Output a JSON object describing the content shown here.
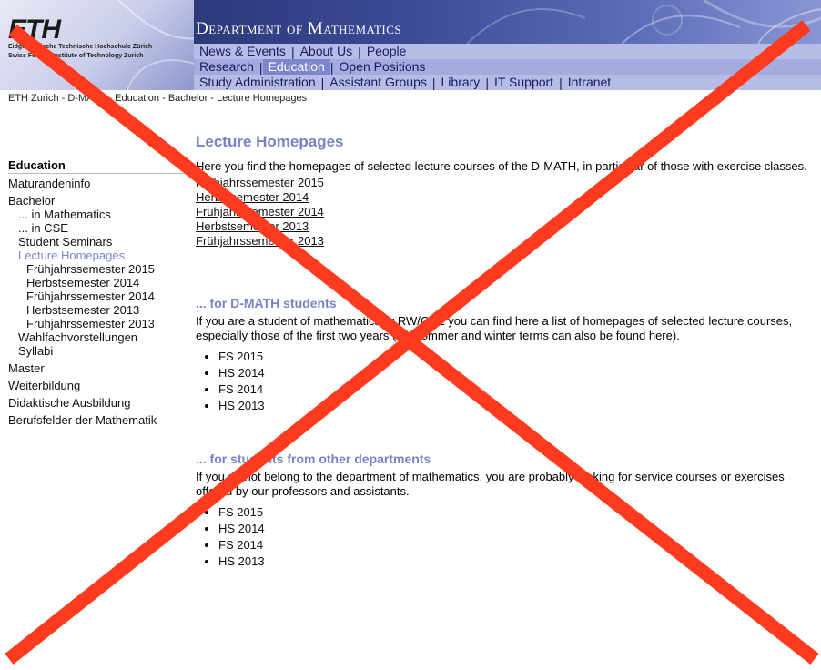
{
  "header": {
    "logo": {
      "wordmark": "ETH",
      "line1": "Eidgenössische Technische Hochschule Zürich",
      "line2": "Swiss Federal Institute of Technology Zurich"
    },
    "dept_title": "Department of Mathematics",
    "nav_rows": [
      {
        "items": [
          {
            "label": "News & Events"
          },
          {
            "label": "About Us"
          },
          {
            "label": "People"
          }
        ]
      },
      {
        "items": [
          {
            "label": "Research"
          },
          {
            "label": "Education",
            "active": true
          },
          {
            "label": "Open Positions"
          }
        ]
      },
      {
        "items": [
          {
            "label": "Study Administration"
          },
          {
            "label": "Assistant Groups"
          },
          {
            "label": "Library"
          },
          {
            "label": "IT Support"
          },
          {
            "label": "Intranet"
          }
        ]
      }
    ],
    "nav_separator": "|"
  },
  "breadcrumb": "ETH Zurich - D-MATH - Education - Bachelor - Lecture Homepages",
  "sidebar": {
    "heading": "Education",
    "items": [
      {
        "label": "Maturandeninfo",
        "level": 1
      },
      {
        "label": "Bachelor",
        "level": 1
      },
      {
        "label": "... in Mathematics",
        "level": 2
      },
      {
        "label": "... in CSE",
        "level": 2
      },
      {
        "label": "Student Seminars",
        "level": 2
      },
      {
        "label": "Lecture Homepages",
        "level": 2,
        "active": true
      },
      {
        "label": "Frühjahrssemester 2015",
        "level": 3
      },
      {
        "label": "Herbstsemester 2014",
        "level": 3
      },
      {
        "label": "Frühjahrssemester 2014",
        "level": 3
      },
      {
        "label": "Herbstsemester 2013",
        "level": 3
      },
      {
        "label": "Frühjahrssemester 2013",
        "level": 3
      },
      {
        "label": "Wahlfachvorstellungen",
        "level": 2
      },
      {
        "label": "Syllabi",
        "level": 2
      },
      {
        "label": "Master",
        "level": 1
      },
      {
        "label": "Weiterbildung",
        "level": 1
      },
      {
        "label": "Didaktische Ausbildung",
        "level": 1
      },
      {
        "label": "Berufsfelder der Mathematik",
        "level": 1
      }
    ]
  },
  "main": {
    "title": "Lecture Homepages",
    "intro": "Here you find the homepages of selected lecture courses of the D-MATH, in particular of those with exercise classes.",
    "term_links": [
      "Frühjahrssemester 2015",
      "Herbstsemester 2014",
      "Frühjahrssemester 2014",
      "Herbstsemester 2013",
      "Frühjahrssemester 2013"
    ],
    "dmath_section": {
      "heading": "... for D-MATH students",
      "text": "If you are a student of mathematics or RW/CSE you can find here a list of homepages of selected lecture courses, especially those of the first two years (old sommer and winter terms can also be found here).",
      "links": [
        "FS 2015",
        "HS 2014",
        "FS 2014",
        "HS 2013"
      ]
    },
    "other_section": {
      "heading": "... for students from other departments",
      "text": "If you do not belong to the department of mathematics, you are probably looking for service courses or exercises offered by our professors and assistants.",
      "links": [
        "FS 2015",
        "HS 2014",
        "FS 2014",
        "HS 2013"
      ]
    }
  },
  "overlay": {
    "cross_color": "#ff3b1f"
  }
}
